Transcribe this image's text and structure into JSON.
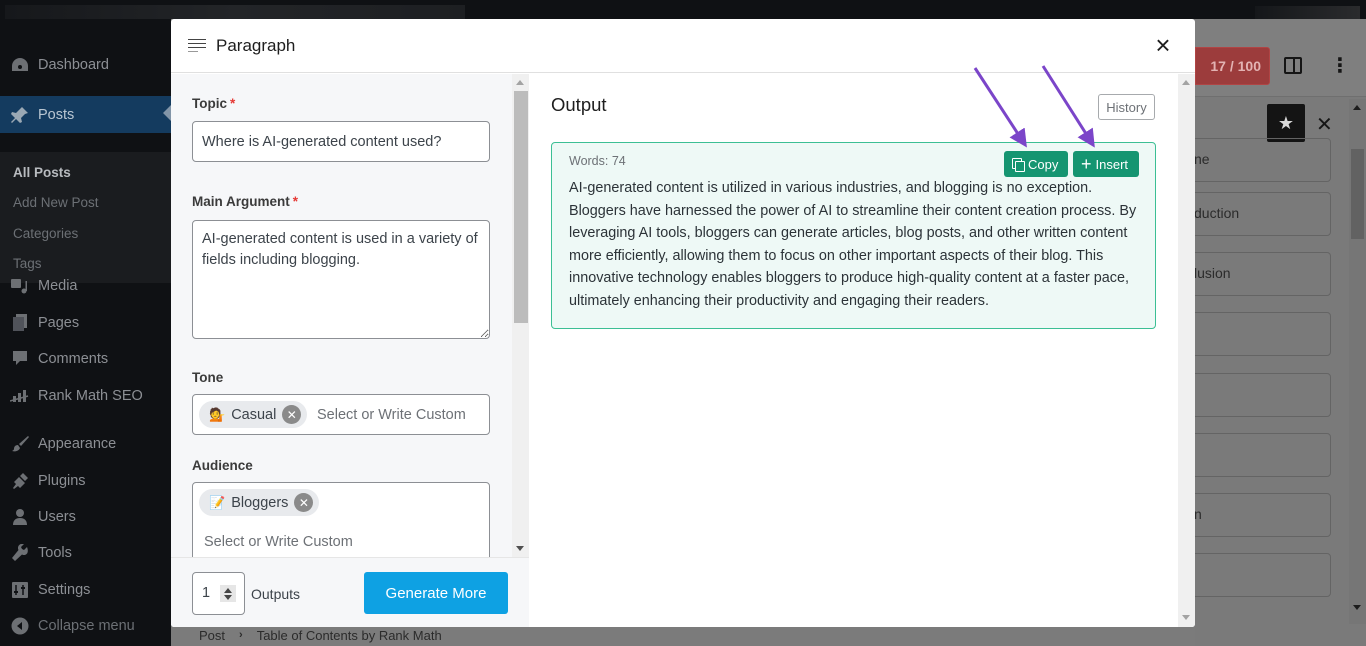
{
  "sidebar": {
    "items": [
      {
        "label": "Dashboard",
        "icon": "dashboard-icon"
      },
      {
        "label": "Posts",
        "icon": "pin-icon",
        "active": true
      },
      {
        "label": "Media",
        "icon": "media-icon"
      },
      {
        "label": "Pages",
        "icon": "pages-icon"
      },
      {
        "label": "Comments",
        "icon": "comments-icon"
      },
      {
        "label": "Rank Math SEO",
        "icon": "rank-math-icon"
      },
      {
        "label": "Appearance",
        "icon": "brush-icon"
      },
      {
        "label": "Plugins",
        "icon": "plug-icon"
      },
      {
        "label": "Users",
        "icon": "user-icon"
      },
      {
        "label": "Tools",
        "icon": "wrench-icon"
      },
      {
        "label": "Settings",
        "icon": "settings-icon"
      }
    ],
    "submenu": [
      "All Posts",
      "Add New Post",
      "Categories",
      "Tags"
    ],
    "collapse_label": "Collapse menu"
  },
  "editor": {
    "score_badge": "17 / 100",
    "breadcrumb": [
      "Post",
      "Table of Contents by Rank Math"
    ],
    "right_boxes": [
      "ne",
      "duction",
      "lusion",
      "",
      "",
      "",
      "n",
      "",
      ""
    ]
  },
  "modal": {
    "title": "Paragraph",
    "close_label": "×",
    "form": {
      "topic_label": "Topic",
      "topic_value": "Where is AI-generated content used?",
      "main_argument_label": "Main Argument",
      "main_argument_value": "AI-generated content is used in a variety of fields including blogging.",
      "tone_label": "Tone",
      "tone_tags": [
        {
          "emoji": "💁",
          "label": "Casual"
        }
      ],
      "tone_placeholder": "Select or Write Custom",
      "audience_label": "Audience",
      "audience_tags": [
        {
          "emoji": "📝",
          "label": "Bloggers"
        }
      ],
      "audience_placeholder": "Select or Write Custom",
      "required_mark": "*"
    },
    "footer": {
      "outputs_value": "1",
      "outputs_label": "Outputs",
      "generate_label": "Generate More"
    },
    "output": {
      "title": "Output",
      "history_label": "History",
      "words": "Words: 74",
      "copy_label": "Copy",
      "insert_label": "Insert",
      "text": "AI-generated content is utilized in various industries, and blogging is no exception. Bloggers have harnessed the power of AI to streamline their content creation process. By leveraging AI tools, bloggers can generate articles, blog posts, and other written content more efficiently, allowing them to focus on other important aspects of their blog. This innovative technology enables bloggers to produce high-quality content at a faster pace, ultimately enhancing their productivity and engaging their readers."
    }
  },
  "colors": {
    "accent_blue": "#0ea1e3",
    "action_green": "#159571",
    "output_border": "#3cbf94",
    "annotation_arrow": "#7b45c9"
  }
}
